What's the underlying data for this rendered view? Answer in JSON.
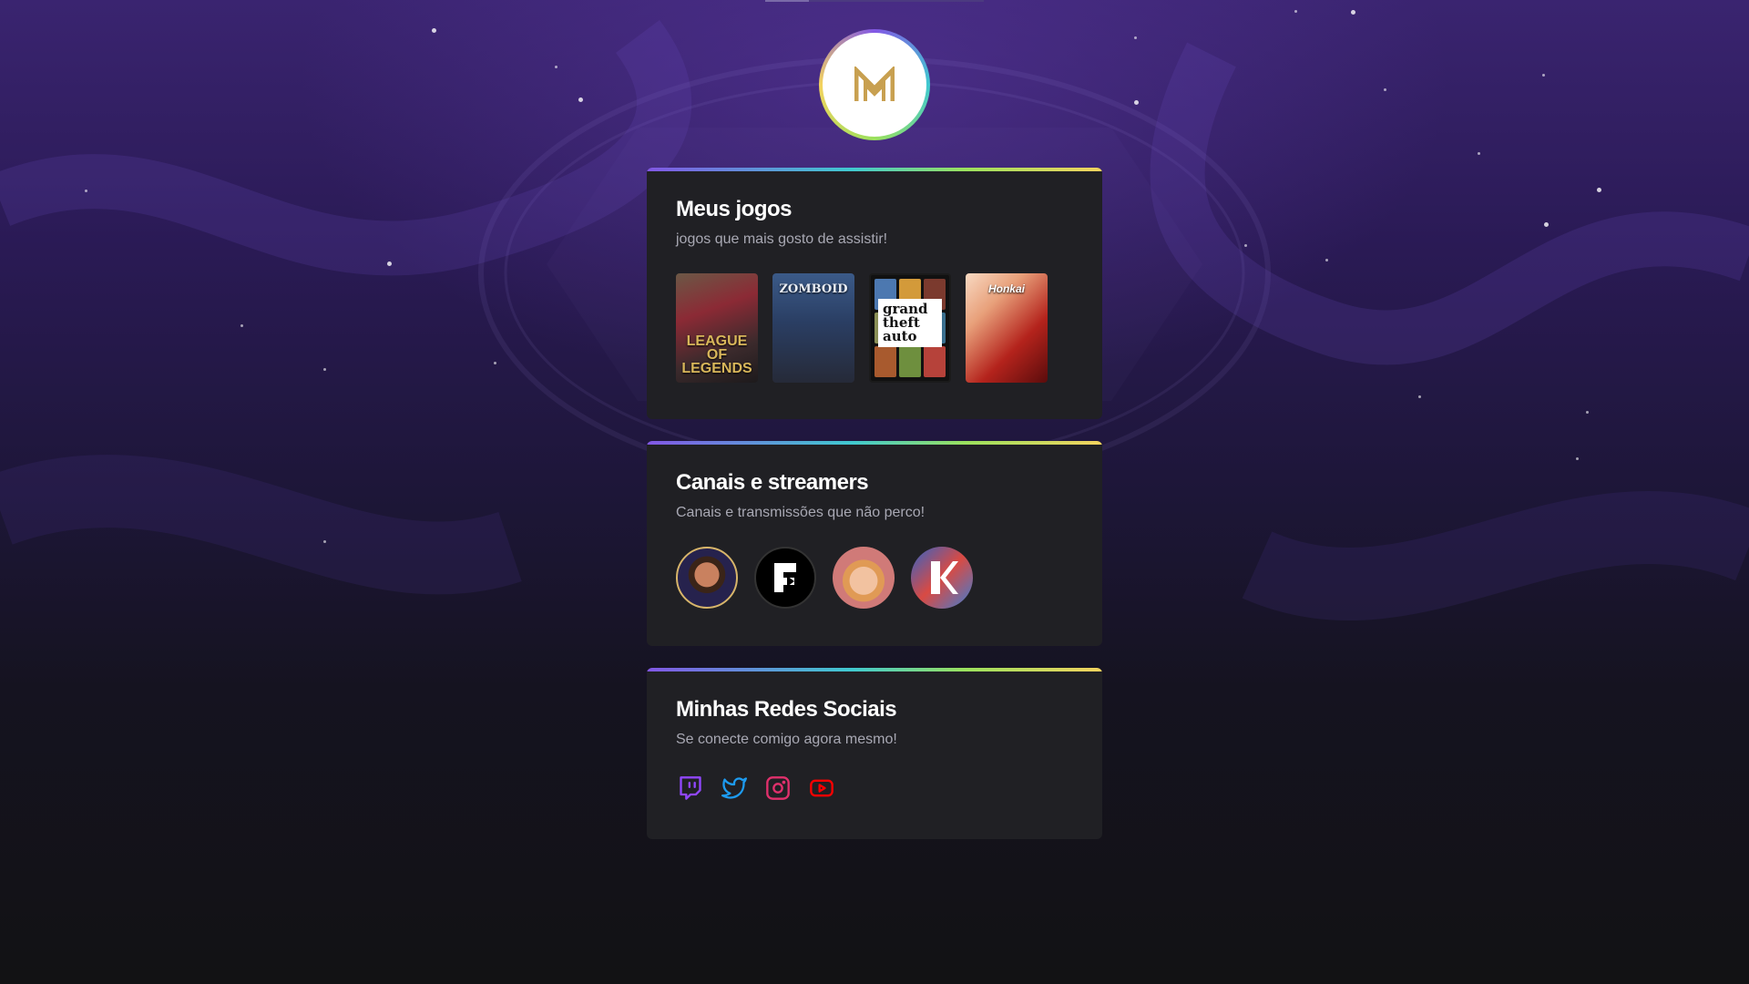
{
  "profile": {
    "avatar_letter": "M",
    "avatar_color": "#c8a050"
  },
  "sections": {
    "games": {
      "title": "Meus jogos",
      "subtitle": "jogos que mais gosto de assistir!",
      "items": [
        {
          "name": "League of Legends",
          "caption": "LEAGUE OF LEGENDS"
        },
        {
          "name": "Project Zomboid",
          "caption": "ZOMBOID"
        },
        {
          "name": "Grand Theft Auto V",
          "caption": "grand theft auto"
        },
        {
          "name": "Honkai Impact",
          "caption": "Honkai"
        }
      ]
    },
    "streamers": {
      "title": "Canais e streamers",
      "subtitle": "Canais e transmissões que não perco!",
      "items": [
        "streamer-1",
        "streamer-2",
        "streamer-3",
        "streamer-4"
      ]
    },
    "social": {
      "title": "Minhas Redes Sociais",
      "subtitle": "Se conecte comigo agora mesmo!",
      "items": [
        {
          "icon": "twitch-icon",
          "color": "#9147ff"
        },
        {
          "icon": "twitter-icon",
          "color": "#1d9bf0"
        },
        {
          "icon": "instagram-icon",
          "color": "#e1306c"
        },
        {
          "icon": "youtube-icon",
          "color": "#ff0000"
        }
      ]
    }
  },
  "colors": {
    "card_bg": "#202024",
    "text_secondary": "#a8a8b3",
    "gradient": [
      "#8257e5",
      "#40c9d0",
      "#9be15d",
      "#f4d35e"
    ]
  }
}
